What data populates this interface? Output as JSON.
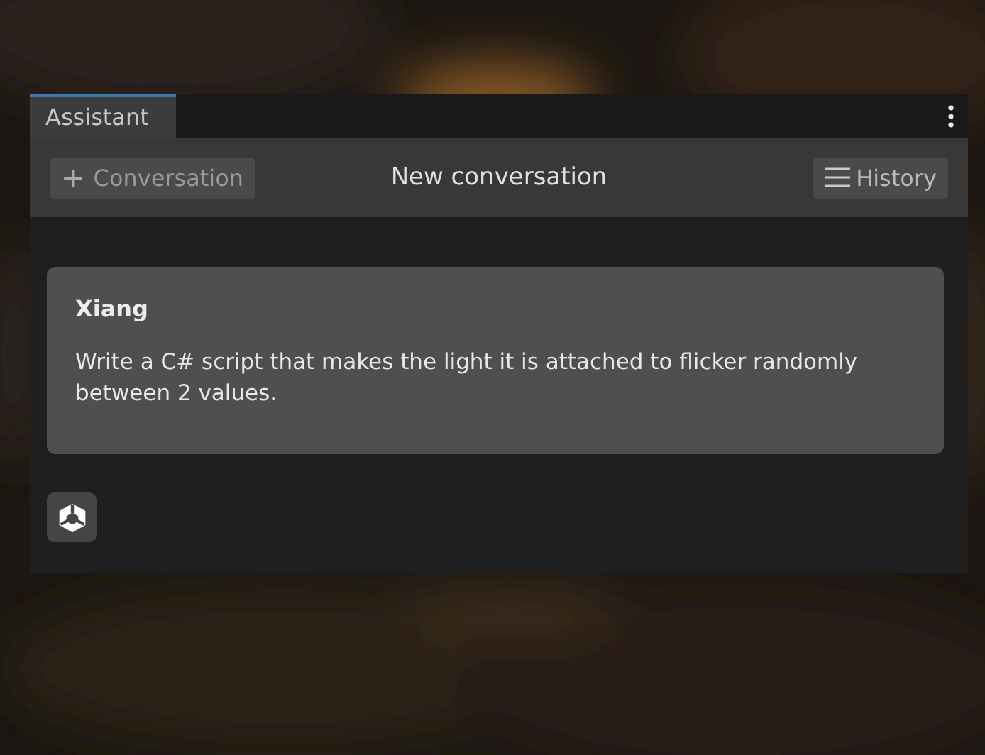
{
  "tabs": [
    {
      "label": "Assistant",
      "selected": true
    }
  ],
  "toolbar": {
    "new_button": {
      "icon": "+",
      "label": "Conversation"
    },
    "title": "New conversation",
    "history_button": {
      "label": "History"
    }
  },
  "messages": [
    {
      "author": "Xiang",
      "text": "Write a C# script that makes the light it is attached to flicker randomly between 2 values."
    }
  ]
}
